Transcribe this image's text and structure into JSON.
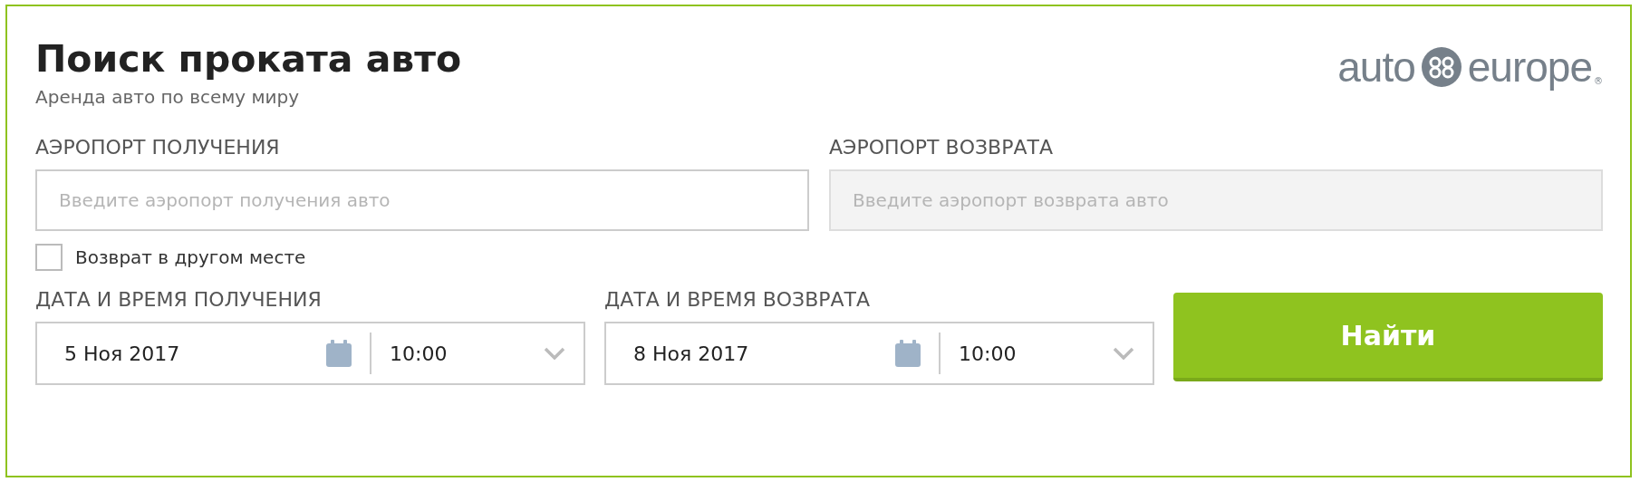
{
  "header": {
    "title": "Поиск проката авто",
    "subtitle": "Аренда авто по всему миру"
  },
  "logo": {
    "left": "auto",
    "right": "europe",
    "mark": "®"
  },
  "airports": [
    {
      "label": "АЭРОПОРТ ПОЛУЧЕНИЯ",
      "placeholder": "Введите аэропорт получения авто",
      "disabled": false
    },
    {
      "label": "АЭРОПОРТ ВОЗВРАТА",
      "placeholder": "Введите аэропорт возврата авто",
      "disabled": true
    }
  ],
  "other_return": {
    "label": "Возврат в другом месте",
    "checked": false
  },
  "dates": [
    {
      "label": "ДАТА И ВРЕМЯ ПОЛУЧЕНИЯ",
      "date": "5 Ноя 2017",
      "time": "10:00"
    },
    {
      "label": "ДАТА И ВРЕМЯ ВОЗВРАТА",
      "date": "8 Ноя 2017",
      "time": "10:00"
    }
  ],
  "search_button": "Найти"
}
